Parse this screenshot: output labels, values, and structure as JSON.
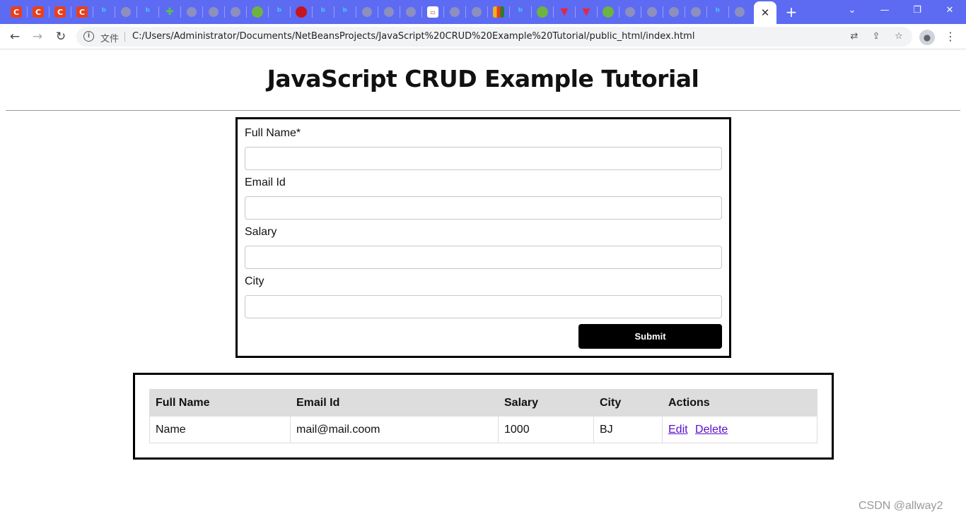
{
  "browser": {
    "active_tab_close": "✕",
    "new_tab": "+",
    "url_scheme_label": "文件",
    "url": "C:/Users/Administrator/Documents/NetBeansProjects/JavaScript%20CRUD%20Example%20Tutorial/public_html/index.html",
    "favicons": [
      "c",
      "c",
      "c",
      "c",
      "bing",
      "globe",
      "bing",
      "puzzle",
      "globe",
      "globe",
      "globe",
      "leaf",
      "bing",
      "red",
      "bing",
      "bing",
      "globe",
      "globe",
      "globe",
      "dash",
      "globe",
      "globe",
      "grid",
      "bing",
      "leaf",
      "vee",
      "vee",
      "leaf",
      "globe",
      "globe",
      "globe",
      "globe",
      "bing",
      "globe"
    ]
  },
  "page": {
    "title": "JavaScript CRUD Example Tutorial"
  },
  "form": {
    "full_name_label": "Full Name*",
    "email_label": "Email Id",
    "salary_label": "Salary",
    "city_label": "City",
    "full_name_value": "",
    "email_value": "",
    "salary_value": "",
    "city_value": "",
    "submit_label": "Submit"
  },
  "table": {
    "headers": {
      "full_name": "Full Name",
      "email": "Email Id",
      "salary": "Salary",
      "city": "City",
      "actions": "Actions"
    },
    "rows": [
      {
        "full_name": "Name",
        "email": "mail@mail.coom",
        "salary": "1000",
        "city": "BJ",
        "edit": "Edit",
        "delete": "Delete"
      }
    ]
  },
  "watermark": "CSDN @allway2"
}
